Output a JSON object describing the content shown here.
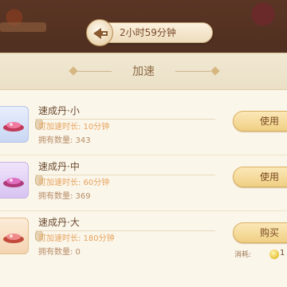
{
  "timer": {
    "text": "2小时59分钟",
    "icon": "speedup-arrow-icon"
  },
  "panel": {
    "title": "加速"
  },
  "items": [
    {
      "name": "速成丹·小",
      "duration": "可加速时长: 10分钟",
      "owned": "拥有数量: 343",
      "action": "使用"
    },
    {
      "name": "速成丹·中",
      "duration": "可加速时长: 60分钟",
      "owned": "拥有数量: 369",
      "action": "使用"
    },
    {
      "name": "速成丹·大",
      "duration": "可加速时长: 180分钟",
      "owned": "拥有数量: 0",
      "action": "购买",
      "cost_label": "消耗:",
      "cost_value": "1"
    }
  ],
  "colors": {
    "accent_orange": "#e6a35e",
    "button_gold": "#f0cf84",
    "panel_bg": "#fbf6ea"
  }
}
